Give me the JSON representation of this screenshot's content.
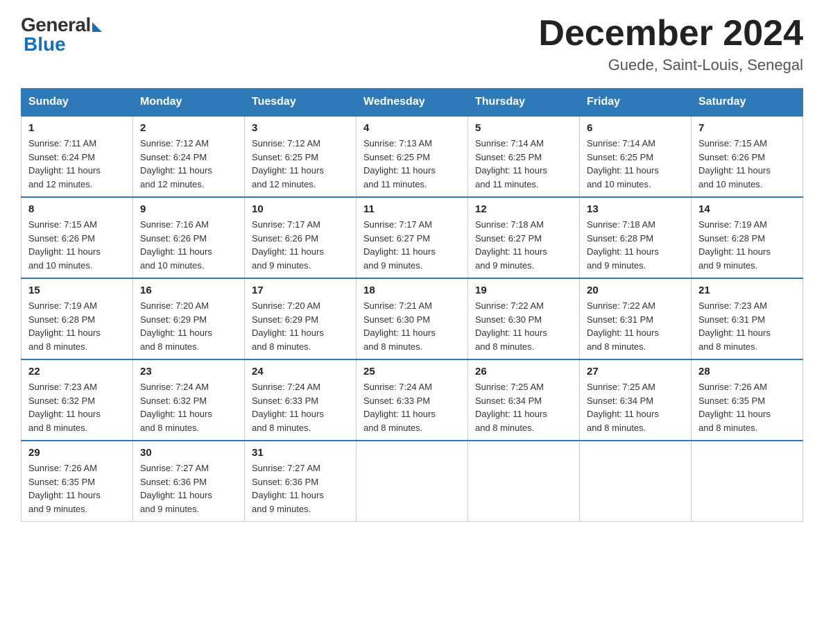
{
  "logo": {
    "general": "General",
    "blue": "Blue"
  },
  "title": "December 2024",
  "location": "Guede, Saint-Louis, Senegal",
  "days_of_week": [
    "Sunday",
    "Monday",
    "Tuesday",
    "Wednesday",
    "Thursday",
    "Friday",
    "Saturday"
  ],
  "weeks": [
    [
      {
        "day": "1",
        "sunrise": "7:11 AM",
        "sunset": "6:24 PM",
        "daylight": "11 hours and 12 minutes."
      },
      {
        "day": "2",
        "sunrise": "7:12 AM",
        "sunset": "6:24 PM",
        "daylight": "11 hours and 12 minutes."
      },
      {
        "day": "3",
        "sunrise": "7:12 AM",
        "sunset": "6:25 PM",
        "daylight": "11 hours and 12 minutes."
      },
      {
        "day": "4",
        "sunrise": "7:13 AM",
        "sunset": "6:25 PM",
        "daylight": "11 hours and 11 minutes."
      },
      {
        "day": "5",
        "sunrise": "7:14 AM",
        "sunset": "6:25 PM",
        "daylight": "11 hours and 11 minutes."
      },
      {
        "day": "6",
        "sunrise": "7:14 AM",
        "sunset": "6:25 PM",
        "daylight": "11 hours and 10 minutes."
      },
      {
        "day": "7",
        "sunrise": "7:15 AM",
        "sunset": "6:26 PM",
        "daylight": "11 hours and 10 minutes."
      }
    ],
    [
      {
        "day": "8",
        "sunrise": "7:15 AM",
        "sunset": "6:26 PM",
        "daylight": "11 hours and 10 minutes."
      },
      {
        "day": "9",
        "sunrise": "7:16 AM",
        "sunset": "6:26 PM",
        "daylight": "11 hours and 10 minutes."
      },
      {
        "day": "10",
        "sunrise": "7:17 AM",
        "sunset": "6:26 PM",
        "daylight": "11 hours and 9 minutes."
      },
      {
        "day": "11",
        "sunrise": "7:17 AM",
        "sunset": "6:27 PM",
        "daylight": "11 hours and 9 minutes."
      },
      {
        "day": "12",
        "sunrise": "7:18 AM",
        "sunset": "6:27 PM",
        "daylight": "11 hours and 9 minutes."
      },
      {
        "day": "13",
        "sunrise": "7:18 AM",
        "sunset": "6:28 PM",
        "daylight": "11 hours and 9 minutes."
      },
      {
        "day": "14",
        "sunrise": "7:19 AM",
        "sunset": "6:28 PM",
        "daylight": "11 hours and 9 minutes."
      }
    ],
    [
      {
        "day": "15",
        "sunrise": "7:19 AM",
        "sunset": "6:28 PM",
        "daylight": "11 hours and 8 minutes."
      },
      {
        "day": "16",
        "sunrise": "7:20 AM",
        "sunset": "6:29 PM",
        "daylight": "11 hours and 8 minutes."
      },
      {
        "day": "17",
        "sunrise": "7:20 AM",
        "sunset": "6:29 PM",
        "daylight": "11 hours and 8 minutes."
      },
      {
        "day": "18",
        "sunrise": "7:21 AM",
        "sunset": "6:30 PM",
        "daylight": "11 hours and 8 minutes."
      },
      {
        "day": "19",
        "sunrise": "7:22 AM",
        "sunset": "6:30 PM",
        "daylight": "11 hours and 8 minutes."
      },
      {
        "day": "20",
        "sunrise": "7:22 AM",
        "sunset": "6:31 PM",
        "daylight": "11 hours and 8 minutes."
      },
      {
        "day": "21",
        "sunrise": "7:23 AM",
        "sunset": "6:31 PM",
        "daylight": "11 hours and 8 minutes."
      }
    ],
    [
      {
        "day": "22",
        "sunrise": "7:23 AM",
        "sunset": "6:32 PM",
        "daylight": "11 hours and 8 minutes."
      },
      {
        "day": "23",
        "sunrise": "7:24 AM",
        "sunset": "6:32 PM",
        "daylight": "11 hours and 8 minutes."
      },
      {
        "day": "24",
        "sunrise": "7:24 AM",
        "sunset": "6:33 PM",
        "daylight": "11 hours and 8 minutes."
      },
      {
        "day": "25",
        "sunrise": "7:24 AM",
        "sunset": "6:33 PM",
        "daylight": "11 hours and 8 minutes."
      },
      {
        "day": "26",
        "sunrise": "7:25 AM",
        "sunset": "6:34 PM",
        "daylight": "11 hours and 8 minutes."
      },
      {
        "day": "27",
        "sunrise": "7:25 AM",
        "sunset": "6:34 PM",
        "daylight": "11 hours and 8 minutes."
      },
      {
        "day": "28",
        "sunrise": "7:26 AM",
        "sunset": "6:35 PM",
        "daylight": "11 hours and 8 minutes."
      }
    ],
    [
      {
        "day": "29",
        "sunrise": "7:26 AM",
        "sunset": "6:35 PM",
        "daylight": "11 hours and 9 minutes."
      },
      {
        "day": "30",
        "sunrise": "7:27 AM",
        "sunset": "6:36 PM",
        "daylight": "11 hours and 9 minutes."
      },
      {
        "day": "31",
        "sunrise": "7:27 AM",
        "sunset": "6:36 PM",
        "daylight": "11 hours and 9 minutes."
      },
      null,
      null,
      null,
      null
    ]
  ],
  "labels": {
    "sunrise": "Sunrise:",
    "sunset": "Sunset:",
    "daylight": "Daylight:"
  }
}
